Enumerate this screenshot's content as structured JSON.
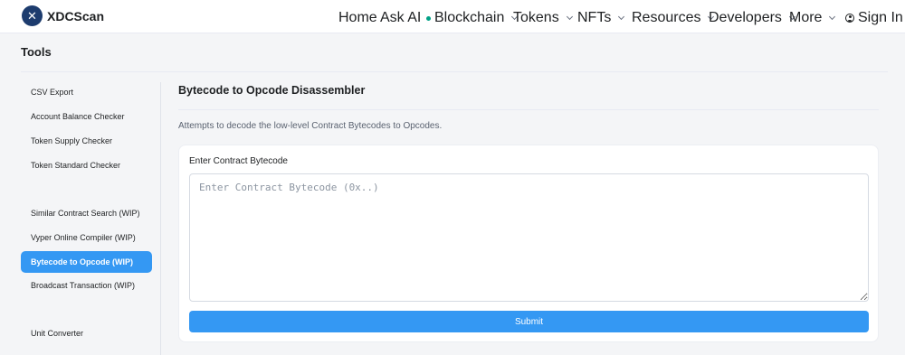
{
  "header": {
    "logo_text": "XDCScan",
    "nav": [
      {
        "label": "Home"
      },
      {
        "label": "Ask AI"
      },
      {
        "label": "Blockchain"
      },
      {
        "label": "Tokens"
      },
      {
        "label": "NFTs"
      },
      {
        "label": "Resources"
      },
      {
        "label": "Developers"
      },
      {
        "label": "More"
      }
    ],
    "sign_in": "Sign In"
  },
  "page": {
    "title": "Tools"
  },
  "sidebar": {
    "items": [
      {
        "label": "CSV Export"
      },
      {
        "label": "Account Balance Checker"
      },
      {
        "label": "Token Supply Checker"
      },
      {
        "label": "Token Standard Checker"
      },
      {
        "label": "Similar Contract Search (WIP)"
      },
      {
        "label": "Vyper Online Compiler (WIP)"
      },
      {
        "label": "Bytecode to Opcode (WIP)",
        "active": true
      },
      {
        "label": "Broadcast Transaction (WIP)"
      },
      {
        "label": "Unit Converter"
      }
    ]
  },
  "main": {
    "title": "Bytecode to Opcode Disassembler",
    "description": "Attempts to decode the low-level Contract Bytecodes to Opcodes.",
    "field_label": "Enter Contract Bytecode",
    "input_placeholder": "Enter Contract Bytecode (0x..)",
    "input_value": "",
    "submit_label": "Submit"
  },
  "colors": {
    "accent": "#3498f3",
    "logo": "#1d3c6e",
    "ai_dot": "#00a186"
  }
}
